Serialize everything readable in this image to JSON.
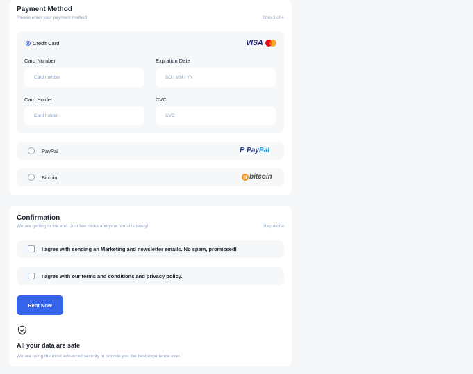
{
  "payment": {
    "title": "Payment Method",
    "subtitle": "Please enter your payment method",
    "step": "Step 3 of 4",
    "credit_card": {
      "label": "Credit Card",
      "logos": {
        "visa": "VISA"
      },
      "card_number": {
        "label": "Card Number",
        "placeholder": "Card number",
        "value": ""
      },
      "expiration": {
        "label": "Expration Date",
        "placeholder": "DD / MM / YY",
        "value": ""
      },
      "card_holder": {
        "label": "Card Holder",
        "placeholder": "Card holder",
        "value": ""
      },
      "cvc": {
        "label": "CVC",
        "placeholder": "CVC",
        "value": ""
      }
    },
    "paypal": {
      "label": "PayPal",
      "logo_pay": "Pay",
      "logo_pal": "Pal"
    },
    "bitcoin": {
      "label": "Bitcoin",
      "logo": "bitcoin"
    },
    "selected_method": "Credit Card"
  },
  "confirmation": {
    "title": "Confirmation",
    "subtitle": "We are getting to the end. Just few clicks and your rental is ready!",
    "step": "Step 4 of 4",
    "marketing_agree": "I agree with sending an Marketing and newsletter emails. No spam, promissed!",
    "terms_prefix": "I agree with our",
    "terms_link": "terms and conditions",
    "terms_and": "and",
    "privacy_link": "privacy policy",
    "terms_suffix": ".",
    "rent_button": "Rent Now",
    "safe_title": "All your data are safe",
    "safe_subtitle": "We are using the most advanced security to provide you the best experience ever."
  },
  "colors": {
    "accent": "#3563e9",
    "page_bg": "#f6f7f9",
    "text_primary": "#1a202c",
    "text_secondary": "#90a3bf",
    "visa": "#1a1f71",
    "paypal_dark": "#253b80",
    "paypal_light": "#179bd7",
    "bitcoin": "#f7931a",
    "mastercard_red": "#eb001b",
    "mastercard_yellow": "#f79e1b"
  },
  "icons": {
    "shield": "shield-check-icon",
    "paypal": "paypal-logo",
    "bitcoin": "bitcoin-logo",
    "visa": "visa-logo",
    "mastercard": "mastercard-logo"
  }
}
